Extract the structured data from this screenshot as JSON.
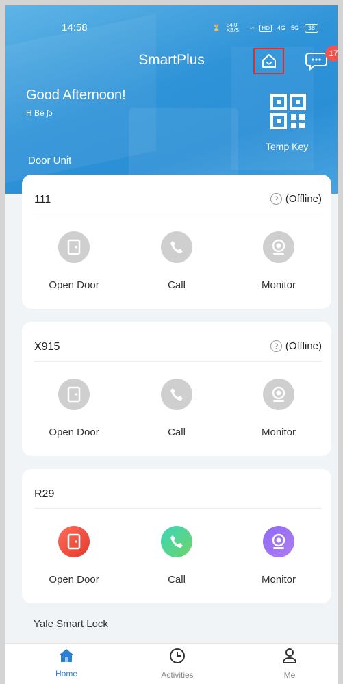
{
  "status_bar": {
    "time": "14:58",
    "net_speed": "54.0 KB/S",
    "hd": "HD",
    "sig1": "4G",
    "sig2": "5G",
    "battery": "38"
  },
  "header": {
    "title": "SmartPlus",
    "message_badge": "17"
  },
  "greeting": {
    "text": "Good Afternoon!",
    "user": "H Bé ʃɔ"
  },
  "temp_key": {
    "label": "Temp Key"
  },
  "section": {
    "door_unit": "Door Unit"
  },
  "devices": [
    {
      "name": "111",
      "status": "(Offline)",
      "actions": [
        "Open Door",
        "Call",
        "Monitor"
      ],
      "online": false
    },
    {
      "name": "X915",
      "status": "(Offline)",
      "actions": [
        "Open Door",
        "Call",
        "Monitor"
      ],
      "online": false
    },
    {
      "name": "R29",
      "status": "",
      "actions": [
        "Open Door",
        "Call",
        "Monitor"
      ],
      "online": true
    }
  ],
  "lock_section": {
    "label": "Yale Smart Lock"
  },
  "nav": [
    {
      "label": "Home",
      "icon": "home-icon",
      "active": true
    },
    {
      "label": "Activities",
      "icon": "clock-icon",
      "active": false
    },
    {
      "label": "Me",
      "icon": "person-icon",
      "active": false
    }
  ],
  "colors": {
    "accent": "#2f93d8",
    "nav_active": "#2f7fd1",
    "highlight": "#d9302c",
    "badge": "#f0544f"
  }
}
